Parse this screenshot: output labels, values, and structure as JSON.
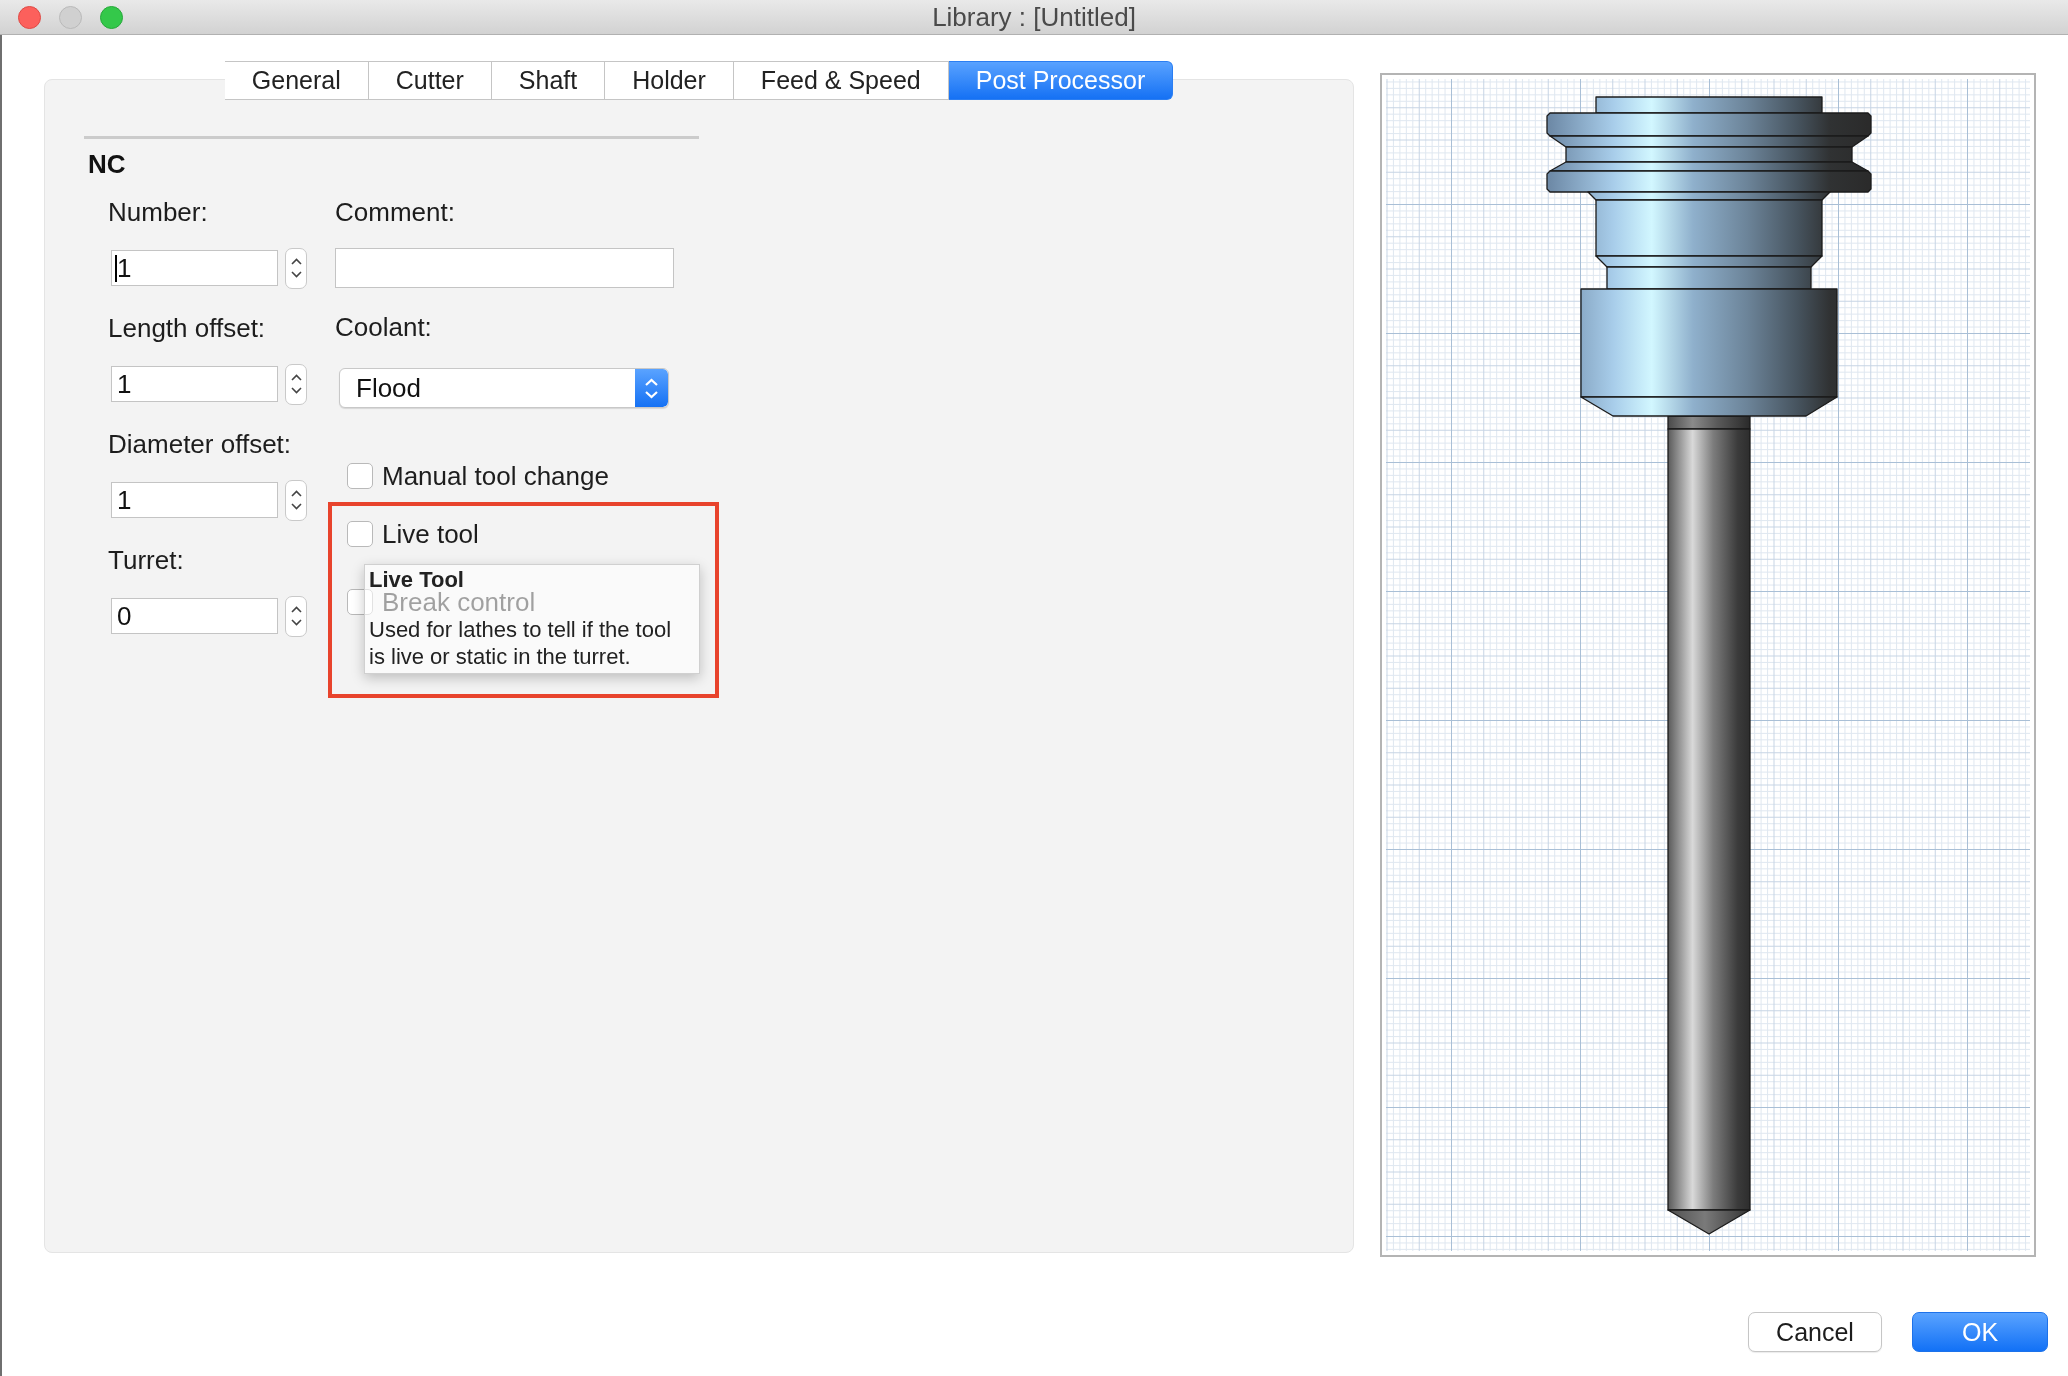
{
  "window": {
    "title": "Library : [Untitled]",
    "minimize_disabled": true
  },
  "tabs": [
    {
      "label": "General",
      "selected": false
    },
    {
      "label": "Cutter",
      "selected": false
    },
    {
      "label": "Shaft",
      "selected": false
    },
    {
      "label": "Holder",
      "selected": false
    },
    {
      "label": "Feed & Speed",
      "selected": false
    },
    {
      "label": "Post Processor",
      "selected": true
    }
  ],
  "nc": {
    "heading": "NC",
    "spin_fields": [
      {
        "label": "Number:",
        "value": "1",
        "focused": true
      },
      {
        "label": "Length offset:",
        "value": "1",
        "focused": false
      },
      {
        "label": "Diameter offset:",
        "value": "1",
        "focused": false
      },
      {
        "label": "Turret:",
        "value": "0",
        "focused": false
      }
    ],
    "comment": {
      "label": "Comment:"
    },
    "coolant": {
      "label": "Coolant:",
      "value": "Flood"
    },
    "options": [
      {
        "label": "Manual tool change",
        "checked": false,
        "highlighted": false
      },
      {
        "label": "Live tool",
        "checked": false,
        "highlighted": true,
        "tooltip": {
          "title": "Live Tool",
          "text": "Used for lathes to tell if the tool is live or static in the turret."
        }
      },
      {
        "label": "Break control",
        "checked": false,
        "highlighted": false
      }
    ]
  },
  "buttons": [
    {
      "label": "Cancel",
      "kind": "cancel"
    },
    {
      "label": "OK",
      "kind": "confirm"
    }
  ]
}
